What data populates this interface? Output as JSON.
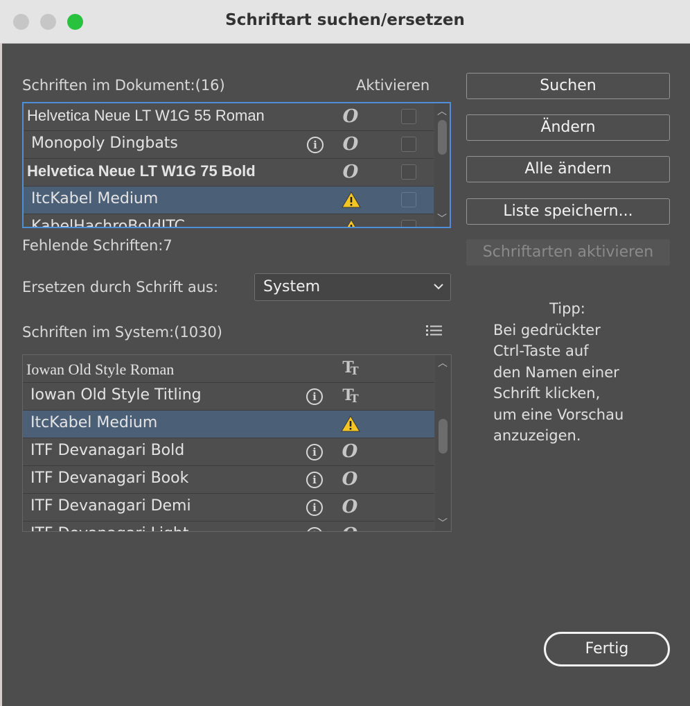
{
  "window": {
    "title": "Schriftart suchen/ersetzen"
  },
  "document_fonts": {
    "header": "Schriften im Dokument:(16)",
    "activate_header": "Aktivieren",
    "items": [
      {
        "name": "Helvetica Neue LT W1G 55 Roman",
        "icons": [
          "opentype-icon"
        ],
        "checked": false
      },
      {
        "name": "Monopoly Dingbats",
        "icons": [
          "info-icon",
          "opentype-icon"
        ],
        "checked": false
      },
      {
        "name": "Helvetica Neue LT W1G 75 Bold",
        "icons": [
          "opentype-icon"
        ],
        "checked": false
      },
      {
        "name": "ItcKabel Medium",
        "icons": [
          "warning-icon"
        ],
        "checked": false,
        "selected": true
      },
      {
        "name": "KabelHachroBoldITC",
        "icons": [
          "warning-icon"
        ],
        "checked": false
      }
    ]
  },
  "missing": {
    "label": "Fehlende Schriften:7"
  },
  "replace": {
    "label": "Ersetzen durch Schrift aus:",
    "value": "System"
  },
  "system_fonts": {
    "header": "Schriften im System:(1030)",
    "items": [
      {
        "name": "Iowan Old Style Roman",
        "icons": [
          "truetype-icon"
        ]
      },
      {
        "name": "Iowan Old Style Titling",
        "icons": [
          "info-icon",
          "truetype-icon"
        ]
      },
      {
        "name": "ItcKabel Medium",
        "icons": [
          "warning-icon"
        ],
        "selected": true
      },
      {
        "name": "ITF Devanagari Bold",
        "icons": [
          "info-icon",
          "opentype-icon"
        ]
      },
      {
        "name": "ITF Devanagari Book",
        "icons": [
          "info-icon",
          "opentype-icon"
        ]
      },
      {
        "name": "ITF Devanagari Demi",
        "icons": [
          "info-icon",
          "opentype-icon"
        ]
      },
      {
        "name": "ITF Devanagari Light",
        "icons": [
          "info-icon",
          "opentype-icon"
        ]
      }
    ]
  },
  "buttons": {
    "search": "Suchen",
    "change": "Ändern",
    "change_all": "Alle ändern",
    "save_list": "Liste speichern...",
    "activate_fonts": "Schriftarten aktivieren",
    "done": "Fertig"
  },
  "tip": {
    "title": "Tipp:",
    "lines": [
      "Bei gedrückter",
      "Ctrl-Taste auf",
      "den Namen einer",
      "Schrift klicken,",
      "um eine Vorschau",
      "anzuzeigen."
    ]
  },
  "colors": {
    "warning": "#f3c623",
    "focus_border": "#4f8fd8",
    "selection": "#4b5f77"
  }
}
